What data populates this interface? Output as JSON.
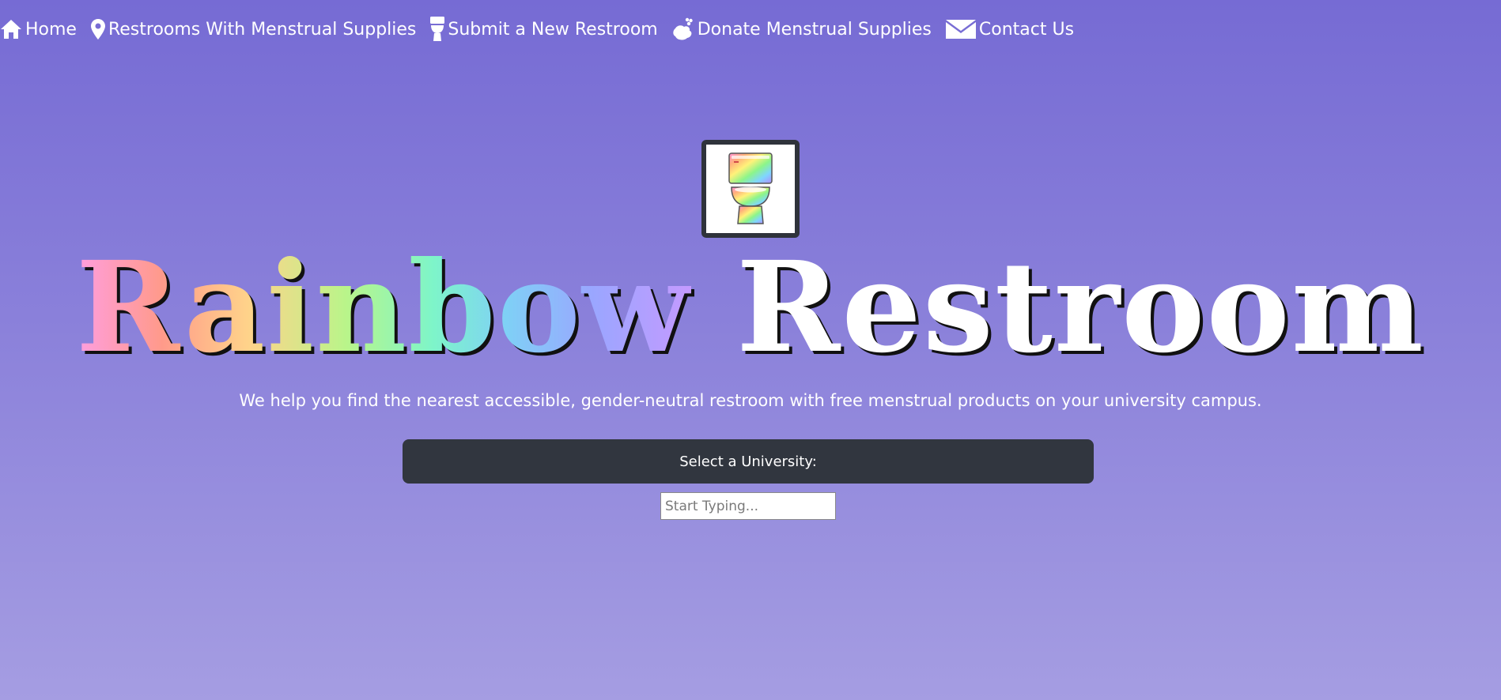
{
  "nav": {
    "items": [
      {
        "label": "Home",
        "icon": "home-icon"
      },
      {
        "label": "Restrooms With Menstrual Supplies",
        "icon": "map-pin-icon"
      },
      {
        "label": "Submit a New Restroom",
        "icon": "toilet-icon"
      },
      {
        "label": "Donate Menstrual Supplies",
        "icon": "hands-icon"
      },
      {
        "label": "Contact Us",
        "icon": "envelope-icon"
      }
    ]
  },
  "hero": {
    "logo_icon": "rainbow-toilet-logo",
    "title_rainbow": "Rainbow",
    "title_plain": "Restroom",
    "tagline": "We help you find the nearest accessible, gender-neutral restroom with free menstrual products on your university campus."
  },
  "university_select": {
    "label": "Select a University:",
    "input_value": "",
    "input_placeholder": "Start Typing..."
  },
  "colors": {
    "background_top": "#766bd4",
    "background_bottom": "#a59de2",
    "panel": "#31363f",
    "text": "#ffffff"
  }
}
